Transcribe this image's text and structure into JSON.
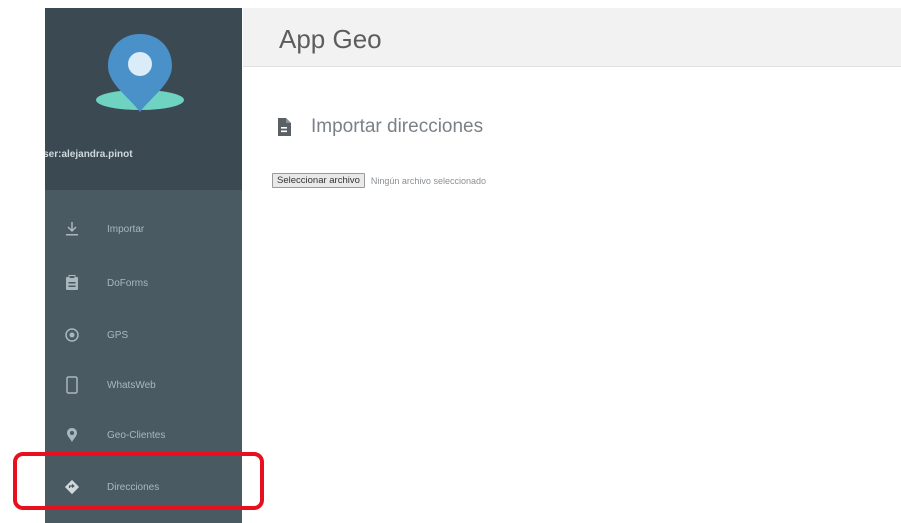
{
  "app": {
    "title": "App Geo"
  },
  "user": {
    "name": "user:alejandra.pinot"
  },
  "sidebar": {
    "items": [
      {
        "label": "Importar",
        "icon": "download-icon"
      },
      {
        "label": "DoForms",
        "icon": "clipboard-icon"
      },
      {
        "label": "GPS",
        "icon": "gps-icon"
      },
      {
        "label": "WhatsWeb",
        "icon": "phone-icon"
      },
      {
        "label": "Geo-Clientes",
        "icon": "location-pin-icon"
      },
      {
        "label": "Direcciones",
        "icon": "directions-icon"
      }
    ]
  },
  "main": {
    "section_title": "Importar direcciones",
    "file_input": {
      "button_label": "Seleccionar archivo",
      "status": "Ningún archivo seleccionado"
    }
  },
  "colors": {
    "sidebar": "#4a5a63",
    "sidebar_top": "#3b4a52",
    "highlight": "#e8101e"
  }
}
